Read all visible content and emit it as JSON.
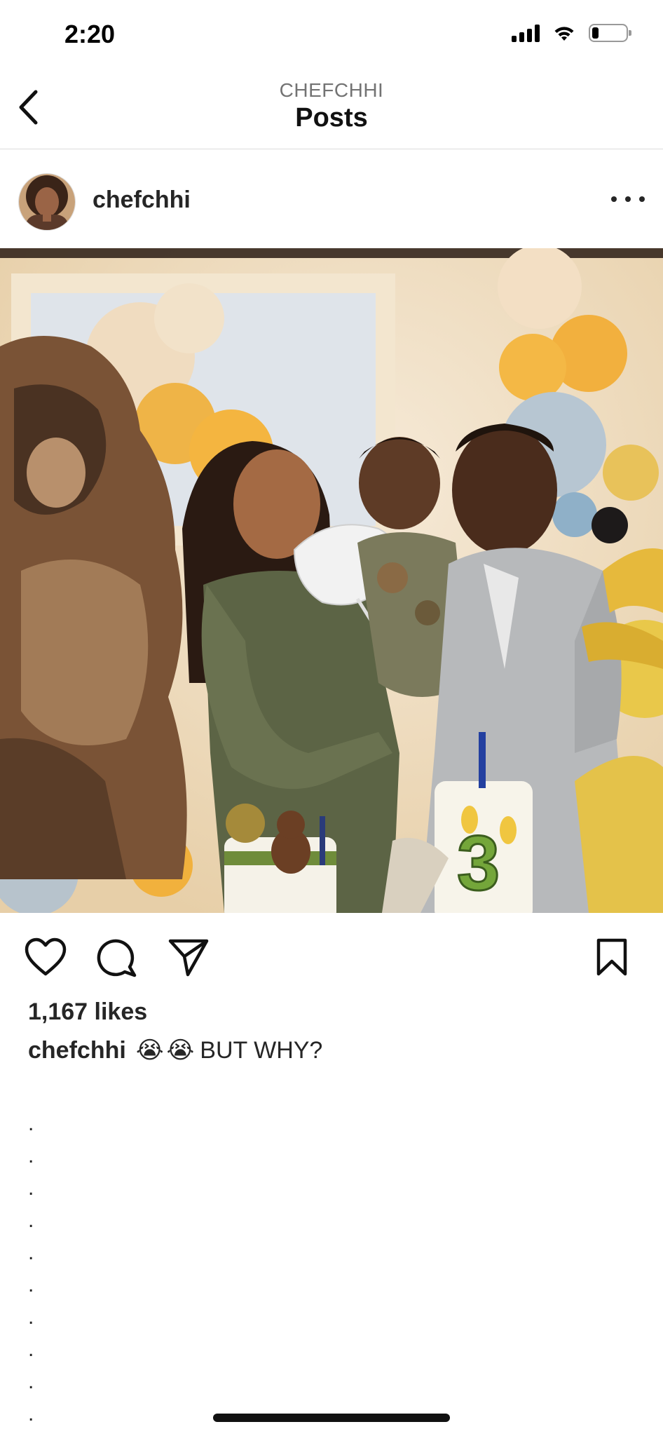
{
  "status_bar": {
    "time": "2:20",
    "battery_level": 0.2
  },
  "header": {
    "account_label": "CHEFCHHI",
    "title": "Posts"
  },
  "post": {
    "username": "chefchhi",
    "image_label": "",
    "likes_text": "1,167 likes",
    "caption_username": "chefchhi",
    "caption_emojis": [
      "😭",
      "😭"
    ],
    "caption_text": "BUT WHY?",
    "caption_dots": [
      ".",
      ".",
      ".",
      ".",
      ".",
      ".",
      ".",
      ".",
      ".",
      "."
    ]
  },
  "icons": {
    "back": "chevron-left-icon",
    "more": "more-horizontal-icon",
    "like": "heart-icon",
    "comment": "comment-icon",
    "share": "send-icon",
    "save": "bookmark-icon"
  },
  "colors": {
    "text": "#262626",
    "muted": "#737373",
    "divider": "#dbdbdb"
  }
}
